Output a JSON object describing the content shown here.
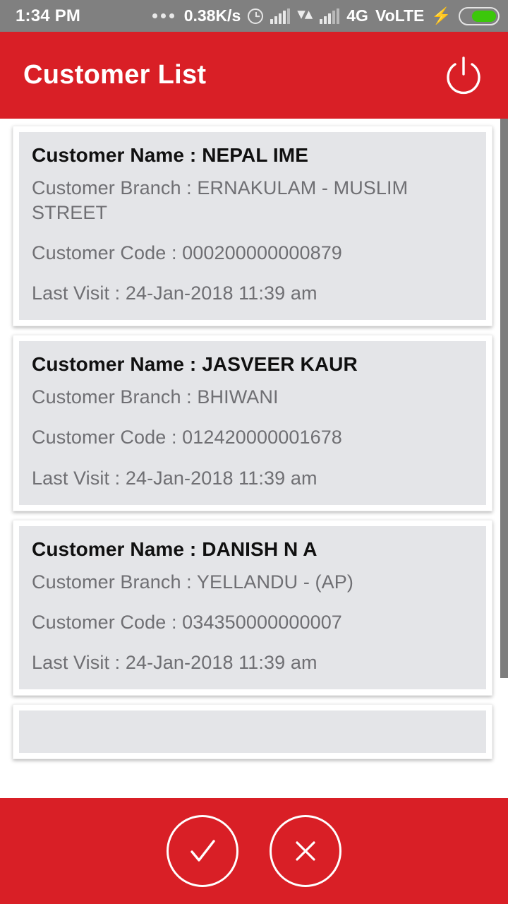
{
  "status_bar": {
    "clock": "1:34 PM",
    "overflow_dots": "...",
    "network_speed": "0.38K/s",
    "alarm_icon": "alarm-clock-icon",
    "signal_icon_1": "signal-bars-icon",
    "data_transfer_icon": "data-transfer-arrows-icon",
    "signal_icon_2": "signal-bars-icon",
    "network_type": "4G",
    "volte": "VoLTE",
    "charging_icon": "lightning-bolt-icon",
    "battery_icon": "battery-icon",
    "battery_level_pct": 70,
    "background_color": "#808080",
    "foreground_color": "#ffffff"
  },
  "app_bar": {
    "title": "Customer List",
    "power_icon": "power-icon",
    "background_color": "#d91f26",
    "text_color": "#ffffff"
  },
  "list": {
    "labels": {
      "name": "Customer Name :",
      "branch": "Customer Branch :",
      "code": "Customer Code :",
      "last_visit": "Last Visit :"
    },
    "card_background": "#e4e5e8",
    "name_color": "#101010",
    "detail_color": "#6f6f73",
    "customers": [
      {
        "name": "Customer Name : NEPAL IME",
        "branch": "Customer Branch : ERNAKULAM - MUSLIM STREET",
        "code": "Customer Code : 000200000000879",
        "last_visit": "Last Visit : 24-Jan-2018 11:39 am"
      },
      {
        "name": "Customer Name : JASVEER KAUR",
        "branch": "Customer Branch : BHIWANI",
        "code": "Customer Code : 012420000001678",
        "last_visit": "Last Visit : 24-Jan-2018 11:39 am"
      },
      {
        "name": "Customer Name : DANISH N A",
        "branch": "Customer Branch : YELLANDU - (AP)",
        "code": "Customer Code : 034350000000007",
        "last_visit": "Last Visit : 24-Jan-2018 11:39 am"
      },
      {
        "name": "",
        "branch": "",
        "code": "",
        "last_visit": ""
      }
    ],
    "scrollbar": {
      "name": "vertical-scrollbar",
      "color": "#7d7d7d"
    }
  },
  "bottom_bar": {
    "background_color": "#d91f26",
    "confirm_icon": "check-icon",
    "cancel_icon": "close-x-icon"
  }
}
